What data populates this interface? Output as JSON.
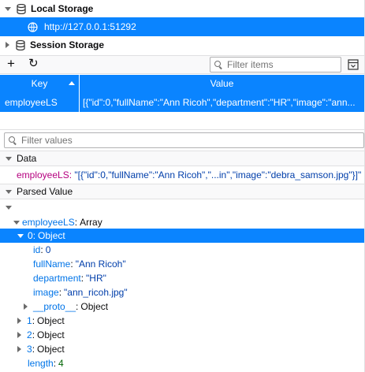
{
  "storage_tree": {
    "local_storage": "Local Storage",
    "local_host": "http://127.0.0.1:51292",
    "session_storage": "Session Storage"
  },
  "toolbar": {
    "add_label": "+",
    "refresh_label": "↻",
    "filter_placeholder": "Filter items"
  },
  "table": {
    "headers": [
      "Key",
      "Value"
    ],
    "rows": [
      {
        "key": "employeeLS",
        "value": "[{\"id\":0,\"fullName\":\"Ann Ricoh\",\"department\":\"HR\",\"image\":\"ann..."
      }
    ]
  },
  "sidebar": {
    "filter_placeholder": "Filter values",
    "data_section": "Data",
    "data_key": "employeeLS",
    "data_value": "\"[{\"id\":0,\"fullName\":\"Ann Ricoh\",\"...in\",\"image\":\"debra_samson.jpg\"}]\"",
    "parsed_section": "Parsed Value",
    "tree": {
      "root_key": "employeeLS",
      "root_type": "Array",
      "item0_key": "0",
      "item0_type": "Object",
      "id_key": "id",
      "id_value": "0",
      "fullName_key": "fullName",
      "fullName_value": "\"Ann Ricoh\"",
      "department_key": "department",
      "department_value": "\"HR\"",
      "image_key": "image",
      "image_value": "\"ann_ricoh.jpg\"",
      "proto_key": "__proto__",
      "proto_type": "Object",
      "item1_key": "1",
      "item1_type": "Object",
      "item2_key": "2",
      "item2_type": "Object",
      "item3_key": "3",
      "item3_type": "Object",
      "length_key": "length",
      "length_value": "4"
    }
  },
  "colors": {
    "selection": "#0a84ff",
    "key_magenta": "#b5007f",
    "string_blue": "#003eaa",
    "number_green": "#006504"
  }
}
